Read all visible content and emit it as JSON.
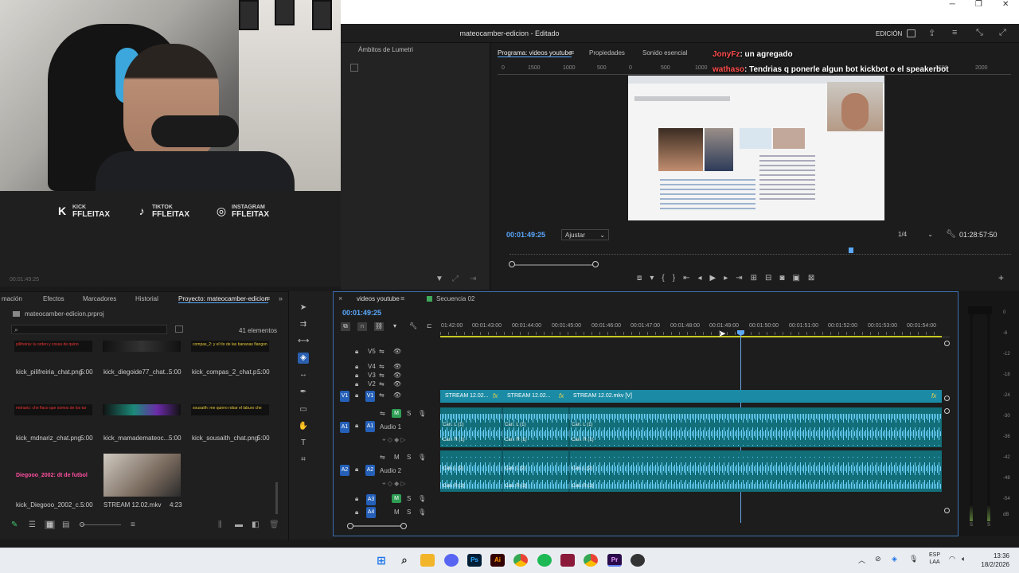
{
  "window": {
    "title": "mateocamber-edicion - Editado",
    "workspace": "EDICIÓN",
    "controls": [
      "─",
      "❐",
      "✕"
    ]
  },
  "stream_overlay": {
    "socials": [
      {
        "platform": "KICK",
        "handle": "FFLEITAX",
        "icon": "kick-icon"
      },
      {
        "platform": "TIKTOK",
        "handle": "FFLEITAX",
        "icon": "tiktok-icon"
      },
      {
        "platform": "INSTAGRAM",
        "handle": "FFLEITAX",
        "icon": "instagram-icon"
      }
    ],
    "source_timecode": "00:01:49:25"
  },
  "lumetri": {
    "title": "Ámbitos de Lumetri"
  },
  "program": {
    "tabs": [
      "Programa: videos youtube",
      "Propiedades",
      "Sonido esencial"
    ],
    "ruler_marks": [
      "0",
      "1500",
      "1000",
      "500",
      "0",
      "500",
      "1000",
      "1500",
      "2000"
    ],
    "chat": [
      {
        "user": "JonyFz",
        "text": ": un agregado",
        "color": "#ff4d4d"
      },
      {
        "user": "wathaso",
        "text": ": Tendrias q ponerle algun bot kickbot o el speakerbot",
        "color": "#ff4d4d"
      }
    ],
    "timecode": "00:01:49:25",
    "fit": "Ajustar",
    "quality": "1/4",
    "duration": "01:28:57:50"
  },
  "project": {
    "tabs": [
      "mación",
      "Efectos",
      "Marcadores",
      "Historial",
      "Proyecto: mateocamber-edicion"
    ],
    "file": "mateocamber-edicion.prproj",
    "count": "41 elementos",
    "items": [
      {
        "name": "kick_pilifreiria_chat.png",
        "dur": "5:00",
        "thumb": "pilifreiria: tu orden y cosas de quino"
      },
      {
        "name": "kick_diegoide77_chat...",
        "dur": "5:00",
        "thumb": ""
      },
      {
        "name": "kick_compas_2_chat.p...",
        "dur": "5:00",
        "thumb": "compas_2: y el tío de las bananas flangon"
      },
      {
        "name": "kick_mdnariz_chat.png",
        "dur": "5:00",
        "thumb": "mdnariz: che flaco que somos de los tar"
      },
      {
        "name": "kick_mamademateoc...",
        "dur": "5:00",
        "thumb": ""
      },
      {
        "name": "kick_sousaith_chat.png",
        "dur": "5:00",
        "thumb": "sousaith: me quiero robar el laburo che"
      },
      {
        "name": "kick_Diegooo_2002_c...",
        "dur": "5:00",
        "thumb": "Diegooo_2002: dt de futbol"
      },
      {
        "name": "STREAM 12.02.mkv",
        "dur": "4:23",
        "thumb": ""
      }
    ]
  },
  "timeline": {
    "tabs": [
      "videos youtube",
      "Secuencia 02"
    ],
    "timecode": "00:01:49:25",
    "ticks": [
      "01:42:00",
      "00:01:43:00",
      "00:01:44:00",
      "00:01:45:00",
      "00:01:46:00",
      "00:01:47:00",
      "00:01:48:00",
      "00:01:49:00",
      "00:01:50:00",
      "00:01:51:00",
      "00:01:52:00",
      "00:01:53:00",
      "00:01:54:00"
    ],
    "tracks": {
      "video": [
        "V5",
        "V4",
        "V3",
        "V2",
        "V1"
      ],
      "audio": [
        {
          "id": "A1",
          "name": "Audio 1"
        },
        {
          "id": "A2",
          "name": "Audio 2"
        },
        {
          "id": "A3",
          "name": ""
        },
        {
          "id": "A4",
          "name": ""
        }
      ]
    },
    "clips": {
      "video": [
        "STREAM 12.02...",
        "STREAM 12.02...",
        "STREAM 12.02.mkv [V]"
      ],
      "channels": [
        "Can. L (1)",
        "Can. R (1)",
        "Can. L (2)",
        "Can. R (2)"
      ]
    }
  },
  "meters": {
    "scale": [
      "0",
      "-6",
      "-12",
      "-18",
      "-24",
      "-30",
      "-36",
      "-42",
      "-48",
      "-54",
      "dB"
    ],
    "labels": [
      "S",
      "S"
    ]
  },
  "taskbar": {
    "apps": [
      {
        "name": "windows-start",
        "color": "#1a73e8"
      },
      {
        "name": "search",
        "color": "#333333"
      },
      {
        "name": "file-explorer",
        "color": "#f2b529"
      },
      {
        "name": "discord",
        "color": "#5865f2"
      },
      {
        "name": "photoshop",
        "color": "#001e36"
      },
      {
        "name": "illustrator",
        "color": "#ff9a00"
      },
      {
        "name": "chrome",
        "color": "#34a853"
      },
      {
        "name": "spotify",
        "color": "#1db954"
      },
      {
        "name": "rar",
        "color": "#8b1a3a"
      },
      {
        "name": "chrome-2",
        "color": "#ea4335"
      },
      {
        "name": "premiere",
        "color": "#2a0a4a"
      },
      {
        "name": "obs",
        "color": "#333333"
      }
    ],
    "lang": [
      "ESP",
      "LAA"
    ],
    "time": "13:36",
    "date": "18/2/2026"
  }
}
